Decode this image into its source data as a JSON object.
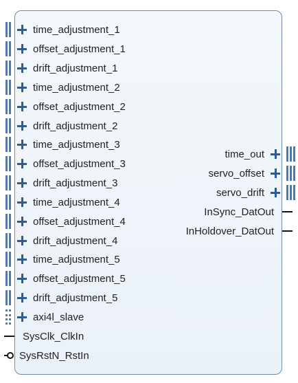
{
  "left_ports": [
    {
      "label": "time_adjustment_1",
      "kind": "bus"
    },
    {
      "label": "offset_adjustment_1",
      "kind": "bus"
    },
    {
      "label": "drift_adjustment_1",
      "kind": "bus"
    },
    {
      "label": "time_adjustment_2",
      "kind": "bus"
    },
    {
      "label": "offset_adjustment_2",
      "kind": "bus"
    },
    {
      "label": "drift_adjustment_2",
      "kind": "bus"
    },
    {
      "label": "time_adjustment_3",
      "kind": "bus"
    },
    {
      "label": "offset_adjustment_3",
      "kind": "bus"
    },
    {
      "label": "drift_adjustment_3",
      "kind": "bus"
    },
    {
      "label": "time_adjustment_4",
      "kind": "bus"
    },
    {
      "label": "offset_adjustment_4",
      "kind": "bus"
    },
    {
      "label": "drift_adjustment_4",
      "kind": "bus"
    },
    {
      "label": "time_adjustment_5",
      "kind": "bus"
    },
    {
      "label": "offset_adjustment_5",
      "kind": "bus"
    },
    {
      "label": "drift_adjustment_5",
      "kind": "bus"
    },
    {
      "label": "axi4l_slave",
      "kind": "dotted-bus"
    },
    {
      "label": "SysClk_ClkIn",
      "kind": "wire"
    },
    {
      "label": "SysRstN_RstIn",
      "kind": "wire-inverted"
    }
  ],
  "right_ports": [
    {
      "label": "time_out",
      "kind": "bus"
    },
    {
      "label": "servo_offset",
      "kind": "bus"
    },
    {
      "label": "servo_drift",
      "kind": "bus"
    },
    {
      "label": "InSync_DatOut",
      "kind": "wire"
    },
    {
      "label": "InHoldover_DatOut",
      "kind": "wire"
    }
  ]
}
